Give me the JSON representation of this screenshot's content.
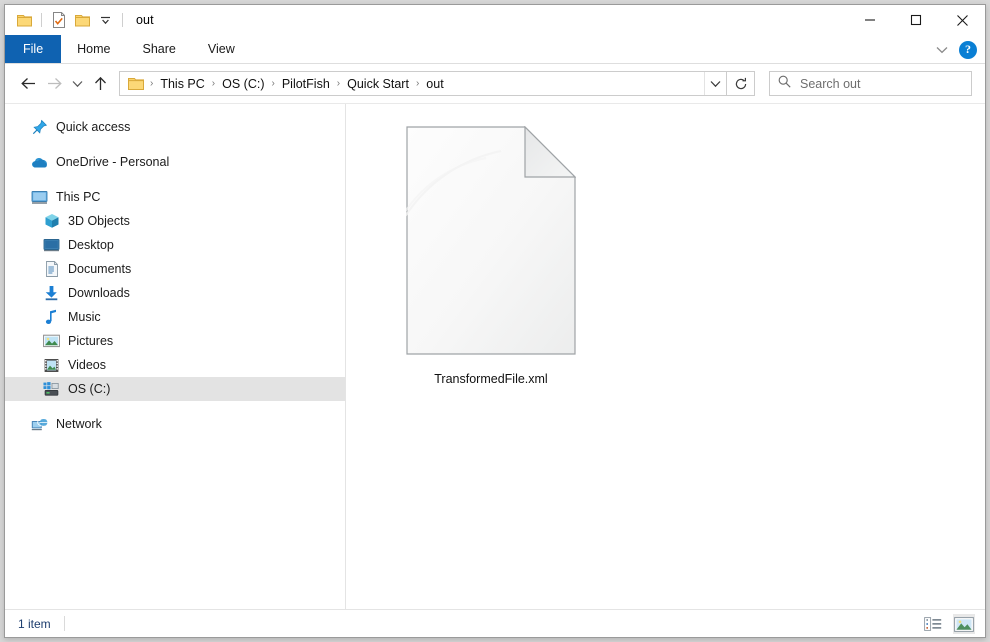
{
  "window": {
    "title": "out",
    "quick_access_toolbar": [
      {
        "name": "folder-icon",
        "label": "Folder"
      },
      {
        "name": "properties-icon",
        "label": "Properties"
      },
      {
        "name": "new-folder-icon",
        "label": "New folder"
      },
      {
        "name": "chevron-down-icon",
        "label": "Customize Quick Access Toolbar"
      }
    ],
    "controls": {
      "minimize": "Minimize",
      "maximize": "Maximize",
      "close": "Close"
    }
  },
  "ribbon": {
    "tabs": [
      {
        "label": "File",
        "active": true
      },
      {
        "label": "Home",
        "active": false
      },
      {
        "label": "Share",
        "active": false
      },
      {
        "label": "View",
        "active": false
      }
    ],
    "collapse_label": "Minimize the Ribbon",
    "help_label": "?"
  },
  "navbar": {
    "back_label": "Back",
    "forward_label": "Forward",
    "recent_label": "Recent locations",
    "up_label": "Up",
    "breadcrumbs": [
      "This PC",
      "OS (C:)",
      "PilotFish",
      "Quick Start",
      "out"
    ],
    "separator": "›",
    "dropdown_label": "Previous locations",
    "refresh_label": "Refresh"
  },
  "search": {
    "placeholder": "Search out",
    "value": "",
    "icon": "search-icon"
  },
  "sidebar": {
    "items": [
      {
        "label": "Quick access",
        "icon": "pin-icon",
        "indent": false,
        "selected": false
      },
      {
        "label": "OneDrive - Personal",
        "icon": "cloud-icon",
        "indent": false,
        "selected": false
      },
      {
        "label": "This PC",
        "icon": "monitor-icon",
        "indent": false,
        "selected": false
      },
      {
        "label": "3D Objects",
        "icon": "cube-icon",
        "indent": true,
        "selected": false
      },
      {
        "label": "Desktop",
        "icon": "desktop-icon",
        "indent": true,
        "selected": false
      },
      {
        "label": "Documents",
        "icon": "documents-icon",
        "indent": true,
        "selected": false
      },
      {
        "label": "Downloads",
        "icon": "download-icon",
        "indent": true,
        "selected": false
      },
      {
        "label": "Music",
        "icon": "music-note-icon",
        "indent": true,
        "selected": false
      },
      {
        "label": "Pictures",
        "icon": "pictures-icon",
        "indent": true,
        "selected": false
      },
      {
        "label": "Videos",
        "icon": "videos-icon",
        "indent": true,
        "selected": false
      },
      {
        "label": "OS (C:)",
        "icon": "hard-drive-icon",
        "indent": true,
        "selected": true
      },
      {
        "label": "Network",
        "icon": "network-icon",
        "indent": false,
        "selected": false
      }
    ]
  },
  "content": {
    "files": [
      {
        "name": "TransformedFile.xml",
        "icon": "xml-document-icon",
        "selected": false
      }
    ]
  },
  "statusbar": {
    "item_count": "1 item",
    "views": [
      {
        "name": "details-view-button",
        "label": "Details view",
        "active": false
      },
      {
        "name": "large-icons-view-button",
        "label": "Large icons view",
        "active": true
      }
    ]
  },
  "colors": {
    "accent": "#0f62b1",
    "help_blue": "#0a7fd4",
    "selection_grey": "#e3e3e3",
    "status_text": "#1d3d6e"
  }
}
